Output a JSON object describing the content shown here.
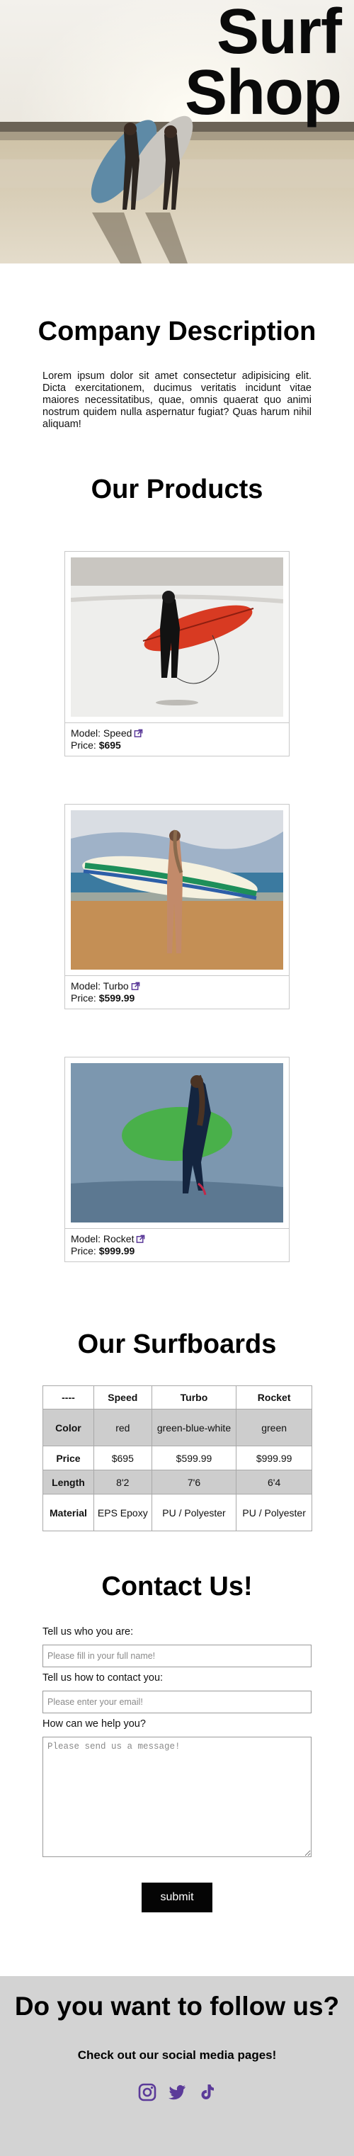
{
  "hero": {
    "title_line1": "Surf",
    "title_line2": "Shop"
  },
  "company": {
    "heading": "Company Description",
    "text": "Lorem ipsum dolor sit amet consectetur adipisicing elit. Dicta exercitationem, ducimus veritatis incidunt vitae maiores necessitatibus, quae, omnis quaerat quo animi nostrum quidem nulla aspernatur fugiat? Quas harum nihil aliquam!"
  },
  "products": {
    "heading": "Our Products",
    "items": [
      {
        "model_label": "Model: Speed",
        "price_label": "Price:",
        "price": "$695"
      },
      {
        "model_label": "Model: Turbo",
        "price_label": "Price:",
        "price": "$599.99"
      },
      {
        "model_label": "Model: Rocket",
        "price_label": "Price:",
        "price": "$999.99"
      }
    ]
  },
  "surfboards": {
    "heading": "Our Surfboards",
    "columns": [
      "----",
      "Speed",
      "Turbo",
      "Rocket"
    ],
    "rows": [
      {
        "label": "Color",
        "values": [
          "red",
          "green-blue-white",
          "green"
        ]
      },
      {
        "label": "Price",
        "values": [
          "$695",
          "$599.99",
          "$999.99"
        ]
      },
      {
        "label": "Length",
        "values": [
          "8'2",
          "7'6",
          "6'4"
        ]
      },
      {
        "label": "Material",
        "values": [
          "EPS Epoxy",
          "PU / Polyester",
          "PU / Polyester"
        ]
      }
    ]
  },
  "contact": {
    "heading": "Contact Us!",
    "name_label": "Tell us who you are:",
    "name_placeholder": "Please fill in your full name!",
    "email_label": "Tell us how to contact you:",
    "email_placeholder": "Please enter your email!",
    "message_label": "How can we help you?",
    "message_placeholder": "Please send us a message!",
    "submit_label": "submit"
  },
  "footer": {
    "heading": "Do you want to follow us?",
    "subtext": "Check out our social media pages!",
    "icons": [
      "instagram-icon",
      "twitter-icon",
      "tiktok-icon"
    ],
    "icon_color": "#5b3a99",
    "background": "#d3d3d3"
  }
}
